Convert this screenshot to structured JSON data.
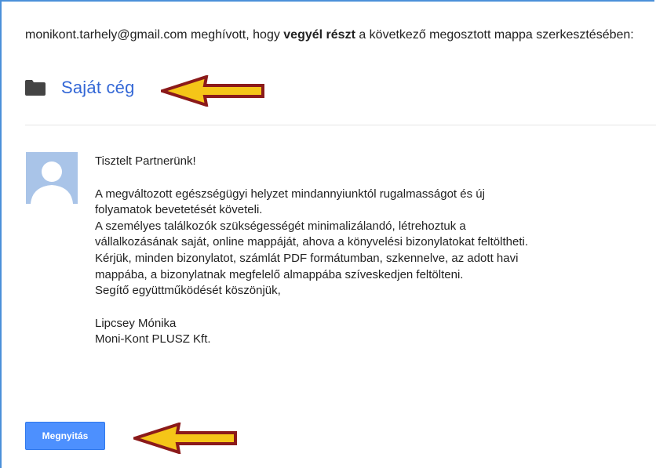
{
  "invite": {
    "sender": "monikont.tarhely@gmail.com",
    "text_before": " meghívott, hogy ",
    "text_bold": "vegyél részt",
    "text_after": " a következő megosztott mappa szerkesztésében:"
  },
  "folder": {
    "name": "Saját cég",
    "icon": "folder-icon"
  },
  "message": {
    "greeting": "Tisztelt Partnerünk!",
    "lines": [
      "A megváltozott egészségügyi helyzet mindannyiunktól rugalmasságot és új",
      "folyamatok bevetetését követeli.",
      "A személyes találkozók szükségességét minimalizálandó, létrehoztuk a",
      "vállalkozásának saját, online mappáját, ahova a könyvelési bizonylatokat feltöltheti.",
      "Kérjük, minden bizonylatot, számlát PDF formátumban, szkennelve, az adott havi",
      "mappába, a bizonylatnak megfelelő almappába szíveskedjen feltölteni.",
      "Segítő együttműködését köszönjük,"
    ],
    "signature_name": "Lipcsey Mónika",
    "signature_company": "Moni-Kont PLUSZ Kft."
  },
  "button": {
    "open_label": "Megnyitás"
  },
  "colors": {
    "link": "#3367d6",
    "button": "#4d90fe",
    "arrow_fill": "#f5c518",
    "arrow_stroke": "#8b1a1a",
    "frame_border": "#4a90d9"
  }
}
